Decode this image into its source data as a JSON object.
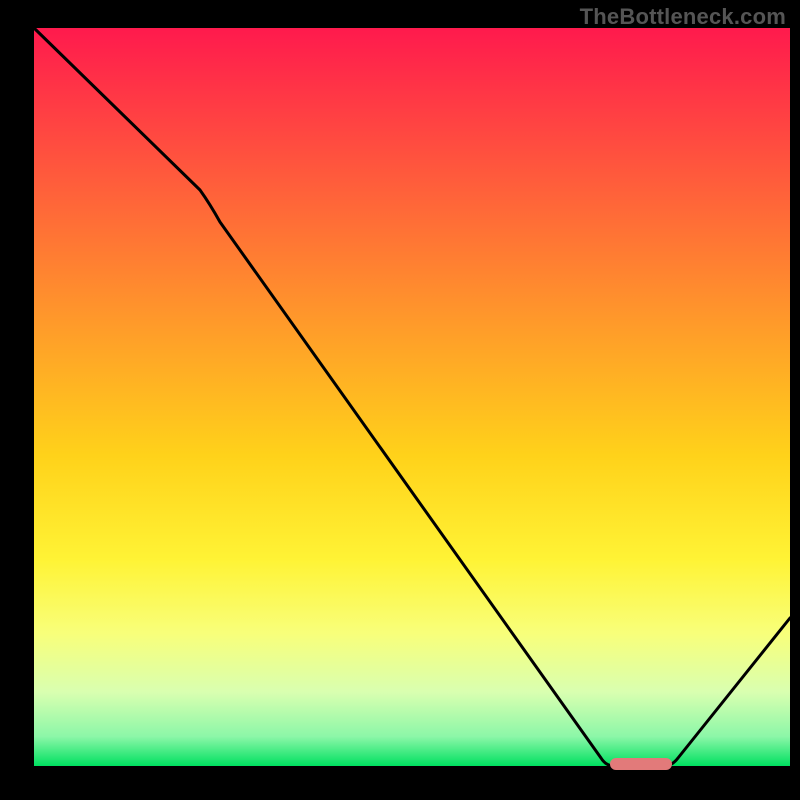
{
  "watermark": "TheBottleneck.com",
  "chart_data": {
    "type": "line",
    "title": "",
    "xlabel": "",
    "ylabel": "",
    "xlim": [
      0,
      100
    ],
    "ylim": [
      0,
      100
    ],
    "x": [
      0,
      22,
      75,
      85,
      100
    ],
    "values": [
      100,
      78,
      0,
      0,
      20
    ],
    "flat_segment": {
      "x_start": 75,
      "x_end": 85,
      "y": 0
    },
    "marker": {
      "x_center": 80,
      "x_width": 8,
      "y": 0,
      "color": "#e27a7a"
    },
    "background_gradient": {
      "stops": [
        {
          "offset": 0.0,
          "color": "#ff1a4d"
        },
        {
          "offset": 0.2,
          "color": "#ff5a3c"
        },
        {
          "offset": 0.4,
          "color": "#ff9a2a"
        },
        {
          "offset": 0.58,
          "color": "#ffd21a"
        },
        {
          "offset": 0.72,
          "color": "#fff335"
        },
        {
          "offset": 0.82,
          "color": "#f8ff7a"
        },
        {
          "offset": 0.9,
          "color": "#d9ffb0"
        },
        {
          "offset": 0.96,
          "color": "#8cf7a8"
        },
        {
          "offset": 1.0,
          "color": "#00e060"
        }
      ]
    },
    "axes_visible": false,
    "grid": false,
    "legend": false
  }
}
